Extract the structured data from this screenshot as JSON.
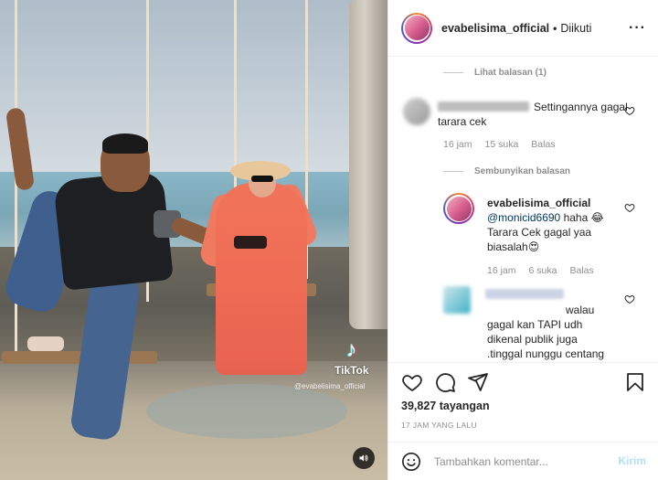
{
  "header": {
    "username": "evabelisima_official",
    "separator": "•",
    "follow_status": "Diikuti",
    "more_label": "···"
  },
  "comments": {
    "view_replies_label": "Lihat balasan (1)",
    "hide_replies_label": "Sembunyikan balasan",
    "items": [
      {
        "text_line1": "Settingannya gagal",
        "text_line2": "tarara cek",
        "time": "16 jam",
        "likes": "15 suka",
        "reply_label": "Balas"
      },
      {
        "username": "evabelisima_official",
        "mention": "@monicid6690",
        "text_after_mention": " haha 😂",
        "text_line2": "Tarara Cek gagal yaa",
        "text_line3": "biasalah😍",
        "time": "16 jam",
        "likes": "6 suka",
        "reply_label": "Balas"
      },
      {
        "text_line1": "walau",
        "text_line2": "gagal kan TAPI udh",
        "text_line3": "dikenal publik juga",
        "text_line4": ".tinggal nunggu centang"
      }
    ]
  },
  "stats": {
    "views": "39,827 tayangan",
    "time_ago": "17 JAM YANG LALU"
  },
  "add_comment": {
    "placeholder": "Tambahkan komentar...",
    "send_label": "Kirim"
  },
  "media": {
    "watermark": "TikTok",
    "handle": "@evabelisima_official"
  },
  "icons": {
    "heart": "heart-icon",
    "comment": "comment-icon",
    "share": "share-icon",
    "save": "bookmark-icon",
    "emoji": "smiley-icon",
    "sound": "speaker-icon",
    "tiktok": "tiktok-logo"
  },
  "colors": {
    "link": "#00376b",
    "muted": "#8e8e8e",
    "send_disabled": "#b2dffc",
    "border": "#efefef"
  }
}
